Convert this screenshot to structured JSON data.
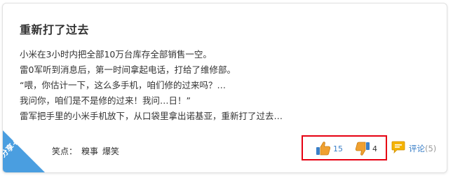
{
  "post": {
    "title": "重新打了过去",
    "lines": [
      "小米在3小时内把全部10万台库存全部销售一空。",
      "雷0军听到消息后，第一时间拿起电话，打给了维修部。",
      "“喂，你估计一下，这么多手机，咱们修的过来吗？…",
      "我问你，咱们是不是修的过来！我问…日！”",
      "雷军把手里的小米手机放下，从口袋里拿出诺基亚，重新打了过去…"
    ]
  },
  "share": {
    "label": "分享+"
  },
  "tags": {
    "label": "笑点：",
    "items": [
      "糗事",
      "爆笑"
    ]
  },
  "votes": {
    "up_count": "15",
    "down_count": "4"
  },
  "comment": {
    "label": "评论",
    "count": "(5)"
  },
  "colors": {
    "accent_blue": "#3a7fc8",
    "highlight_red": "#e60012",
    "ribbon_blue": "#4a9ee0",
    "thumb_orange": "#f0a030"
  },
  "icons": [
    "thumbs-up-icon",
    "thumbs-down-icon",
    "comment-bubble-icon"
  ]
}
